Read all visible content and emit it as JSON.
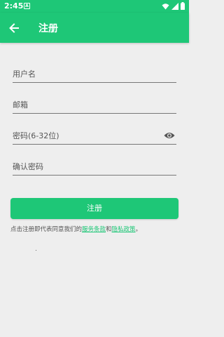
{
  "status_bar": {
    "time": "2:45",
    "notification_icon": "A",
    "icons": [
      "wifi-icon",
      "signal-icon",
      "battery-icon"
    ]
  },
  "app_bar": {
    "title": "注册",
    "back_icon": "arrow-left-icon",
    "background_color": "#1ec777"
  },
  "form": {
    "username_placeholder": "用户名",
    "email_placeholder": "邮箱",
    "password_placeholder": "密码(6-32位)",
    "confirm_password_placeholder": "确认密码",
    "password_toggle_icon": "eye-icon"
  },
  "submit_label": "注册",
  "terms": {
    "prefix": "点击注册即代表同意我们的",
    "service_link": "服务条款",
    "conjunction": "和",
    "privacy_link": "隐私政策",
    "suffix": "。"
  }
}
